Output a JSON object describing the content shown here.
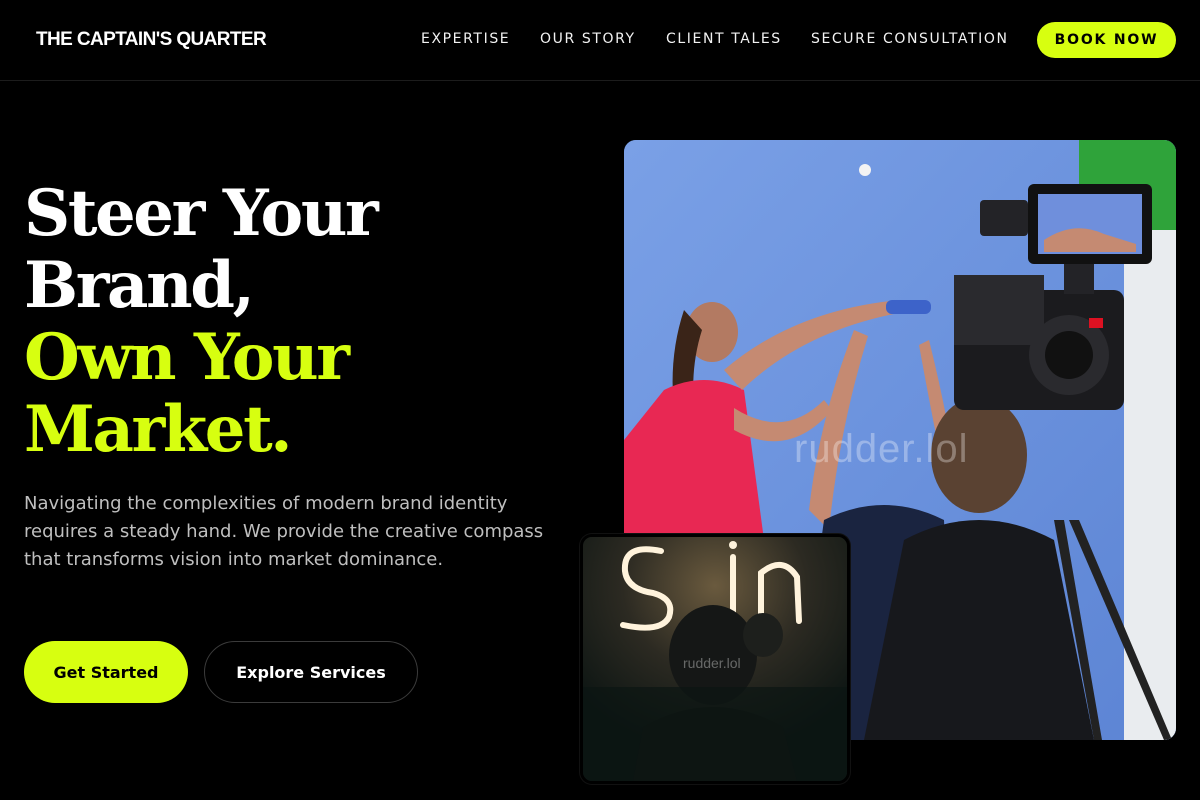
{
  "brand": {
    "name": "THE CAPTAIN'S QUARTER"
  },
  "nav": {
    "items": [
      {
        "label": "EXPERTISE"
      },
      {
        "label": "OUR STORY"
      },
      {
        "label": "CLIENT TALES"
      },
      {
        "label": "SECURE CONSULTATION"
      }
    ],
    "cta_label": "BOOK NOW"
  },
  "hero": {
    "headline_lines": [
      "Steer Your",
      "Brand,",
      "Own Your",
      "Market."
    ],
    "description": "Navigating the complexities of modern brand identity requires a steady hand. We provide the creative compass that transforms vision into market dominance.",
    "primary_button": "Get Started",
    "secondary_button": "Explore Services"
  },
  "images": {
    "main_watermark": "rudder.lol",
    "overlay_watermark": "rudder.lol"
  },
  "colors": {
    "accent": "#d7ff10",
    "background": "#000000",
    "muted_text": "#bfbfbf"
  }
}
